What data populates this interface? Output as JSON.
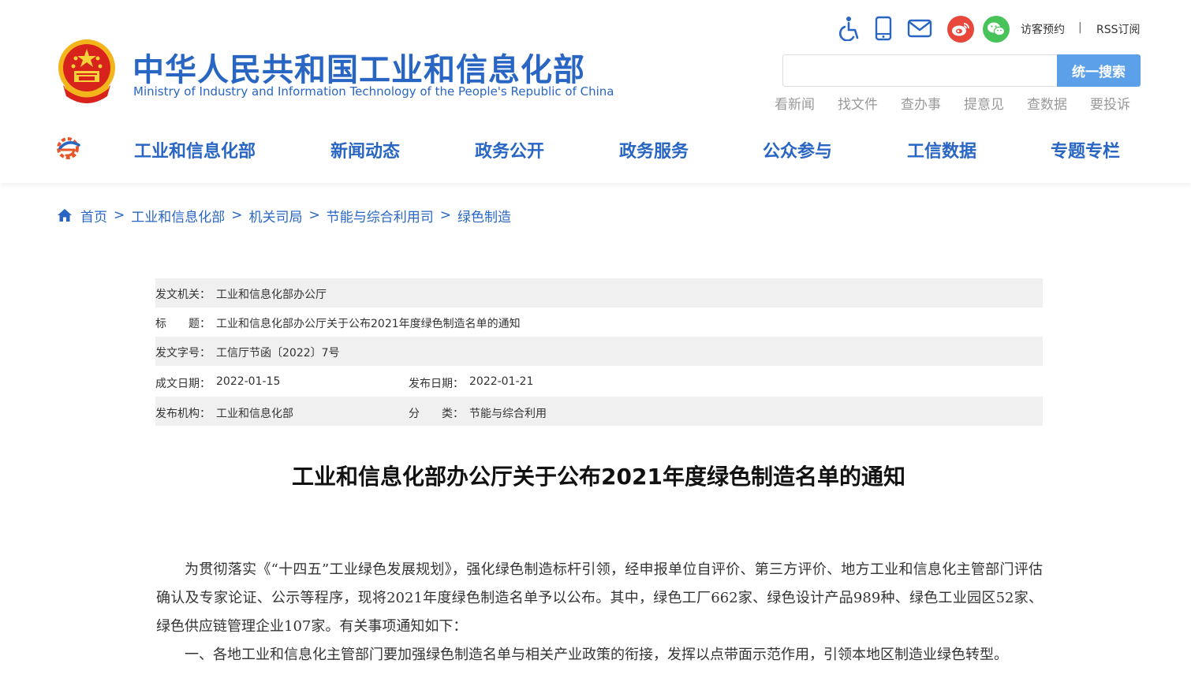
{
  "header": {
    "title": "中华人民共和国工业和信息化部",
    "subtitle": "Ministry of Industry and Information Technology of the People's Republic of China",
    "tools": {
      "icons": [
        "accessibility-icon",
        "mobile-icon",
        "mail-icon",
        "weibo-icon",
        "wechat-icon"
      ],
      "visitor_label": "访客预约",
      "separator": "|",
      "rss_label": "RSS订阅"
    },
    "search": {
      "placeholder": "",
      "button_label": "统一搜索"
    },
    "quick_links": [
      "看新闻",
      "找文件",
      "查办事",
      "提意见",
      "查数据",
      "要投诉"
    ],
    "colors": {
      "brand_blue": "#2966c4",
      "search_button": "#5ba0e8"
    }
  },
  "nav": {
    "items": [
      "工业和信息化部",
      "新闻动态",
      "政务公开",
      "政务服务",
      "公众参与",
      "工信数据",
      "专题专栏"
    ]
  },
  "breadcrumb": {
    "items": [
      "首页",
      "工业和信息化部",
      "机关司局",
      "节能与综合利用司",
      "绿色制造"
    ],
    "separator": ">"
  },
  "meta": {
    "issuer_label": "发文机关：",
    "issuer_value": "工业和信息化部办公厅",
    "title_label": "标　　题：",
    "title_value": "工业和信息化部办公厅关于公布2021年度绿色制造名单的通知",
    "doc_no_label": "发文字号：",
    "doc_no_value": "工信厅节函〔2022〕7号",
    "created_label": "成文日期：",
    "created_value": "2022-01-15",
    "published_label": "发布日期：",
    "published_value": "2022-01-21",
    "org_label": "发布机构：",
    "org_value": "工业和信息化部",
    "category_label": "分　　类：",
    "category_value": "节能与综合利用"
  },
  "document": {
    "title": "工业和信息化部办公厅关于公布2021年度绿色制造名单的通知",
    "paragraphs": [
      "为贯彻落实《“十四五”工业绿色发展规划》，强化绿色制造标杆引领，经申报单位自评价、第三方评价、地方工业和信息化主管部门评估确认及专家论证、公示等程序，现将2021年度绿色制造名单予以公布。其中，绿色工厂662家、绿色设计产品989种、绿色工业园区52家、绿色供应链管理企业107家。有关事项通知如下：",
      "一、各地工业和信息化主管部门要加强绿色制造名单与相关产业政策的衔接，发挥以点带面示范作用，引领本地区制造业绿色转型。"
    ]
  }
}
